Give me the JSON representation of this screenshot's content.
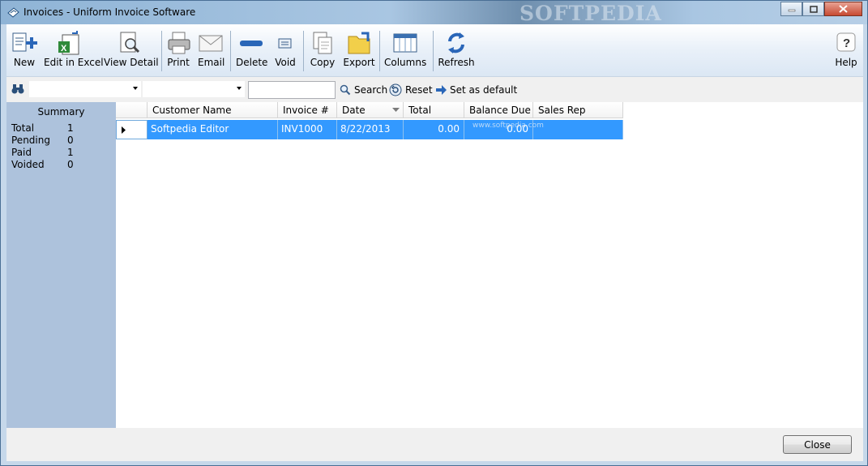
{
  "window": {
    "title": "Invoices - Uniform Invoice Software",
    "watermark": "SOFTPEDIA"
  },
  "toolbar": {
    "new": "New",
    "edit_excel": "Edit in Excel",
    "view_detail": "View Detail",
    "print": "Print",
    "email": "Email",
    "delete": "Delete",
    "void": "Void",
    "copy": "Copy",
    "export": "Export",
    "columns": "Columns",
    "refresh": "Refresh",
    "help": "Help"
  },
  "filter": {
    "combo1_value": "",
    "combo2_value": "",
    "search_text": "",
    "search": "Search",
    "reset": "Reset",
    "set_default": "Set as default"
  },
  "summary": {
    "title": "Summary",
    "rows": [
      {
        "label": "Total",
        "value": "1"
      },
      {
        "label": "Pending",
        "value": "0"
      },
      {
        "label": "Paid",
        "value": "1"
      },
      {
        "label": "Voided",
        "value": "0"
      }
    ]
  },
  "grid": {
    "columns": [
      "Customer Name",
      "Invoice #",
      "Date",
      "Total",
      "Balance Due",
      "Sales Rep"
    ],
    "rows": [
      {
        "customer": "Softpedia Editor",
        "invoice": "INV1000",
        "date": "8/22/2013",
        "total": "0.00",
        "balance": "0.00",
        "rep": ""
      }
    ],
    "overlay_watermark": "www.softpedia.com"
  },
  "footer": {
    "close": "Close"
  }
}
